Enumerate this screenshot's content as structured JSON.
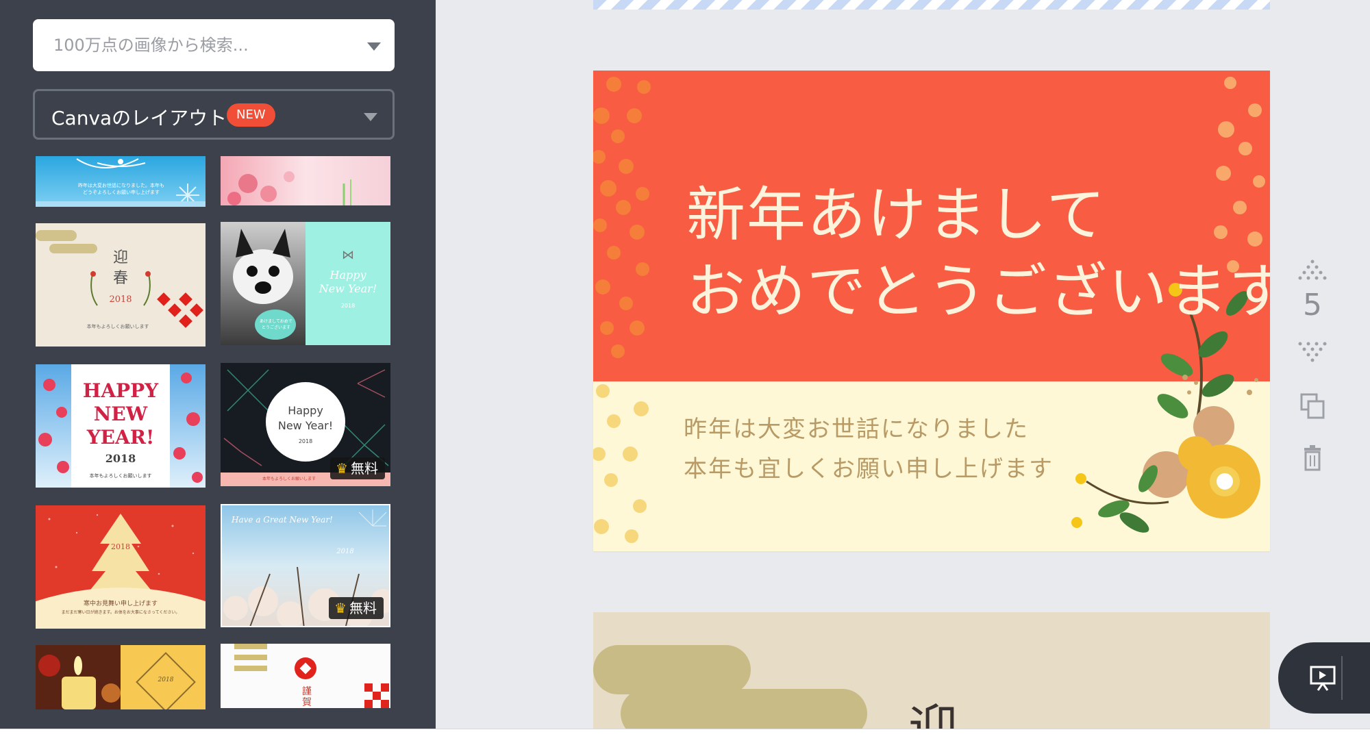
{
  "sidebar": {
    "search": {
      "placeholder": "100万点の画像から検索..."
    },
    "layout_select": {
      "label": "Canvaのレイアウト",
      "badge": "NEW"
    },
    "thumbnails": [
      {
        "text": "昨年は大変お世話になりました。本年もどうぞよろしくお願い申し上げます"
      },
      {
        "text": ""
      },
      {
        "kanji1": "迎",
        "kanji2": "春",
        "year": "2018",
        "footer": "本年もよろしくお願いします"
      },
      {
        "line1": "Happy",
        "line2": "New Year!",
        "year": "2018",
        "bubble": "あけましておめでとうございます"
      },
      {
        "line1": "HAPPY",
        "line2": "NEW",
        "line3": "YEAR!",
        "year": "2018",
        "footer": "本年もよろしくお願いします"
      },
      {
        "line1": "Happy",
        "line2": "New Year!",
        "year": "2018",
        "footer": "本年もよろしくお願いします",
        "badge": "無料"
      },
      {
        "year": "2018",
        "footer1": "寒中お見舞い申し上げます",
        "footer2": "まだまだ寒い日が続きます。お体をお大事になさってください。"
      },
      {
        "line1": "Have a Great New Year!",
        "year": "2018",
        "badge": "無料"
      },
      {
        "year": "2018"
      },
      {
        "text": "謹賀"
      }
    ]
  },
  "card": {
    "title_line1": "新年あけまして",
    "title_line2": "おめでとうございます",
    "sub_line1": "昨年は大変お世話になりました",
    "sub_line2": "本年も宜しくお願い申し上げます"
  },
  "next_page": {
    "kanji": "迎"
  },
  "tools": {
    "page_number": "5",
    "icons": [
      "move-up-icon",
      "move-down-icon",
      "duplicate-icon",
      "trash-icon",
      "present-icon"
    ]
  },
  "colors": {
    "sidebar_bg": "#3c414b",
    "card_red": "#f85d43",
    "card_cream": "#fef8d6",
    "accent_badge": "#f04e37",
    "gold": "#f5c518"
  }
}
